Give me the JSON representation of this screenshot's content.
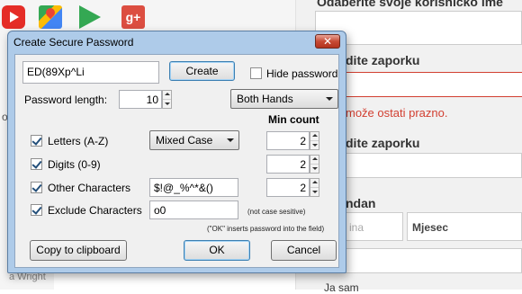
{
  "background": {
    "apps": [
      "youtube-icon",
      "maps-icon",
      "play-store-icon",
      "google-plus-icon"
    ],
    "gplus_label": "g+",
    "side_letter": "o",
    "author_fragment": "a Wright",
    "form": {
      "heading_username": "Odaberite svoje korisničko ime",
      "heading_password": "dite zaporku",
      "error_text": "može ostati prazno.",
      "heading_confirm": "dite zaporku",
      "heading_birthday": "ndan",
      "day_placeholder": "ina",
      "month_select": "Mjesec",
      "heading_bottom": "Ja sam"
    }
  },
  "dialog": {
    "title": "Create Secure Password",
    "close_glyph": "✕",
    "password_value": "ED(89Xp^Li",
    "create_label": "Create",
    "hide_password_label": "Hide password",
    "hide_password_checked": false,
    "password_length_label": "Password length:",
    "password_length_value": "10",
    "hands_select": "Both Hands",
    "min_count_header": "Min count",
    "rows": [
      {
        "label": "Letters (A-Z)",
        "checked": true,
        "option": "Mixed Case",
        "count": "2"
      },
      {
        "label": "Digits (0-9)",
        "checked": true,
        "count": "2"
      },
      {
        "label": "Other Characters",
        "checked": true,
        "chars": "$!@_%^*&()",
        "count": "2"
      },
      {
        "label": "Exclude Characters",
        "checked": true,
        "chars": "o0",
        "note": "(not case sesitive)"
      }
    ],
    "ok_hint": "(\"OK\" inserts password into the field)",
    "copy_label": "Copy to clipboard",
    "ok_label": "OK",
    "cancel_label": "Cancel"
  }
}
